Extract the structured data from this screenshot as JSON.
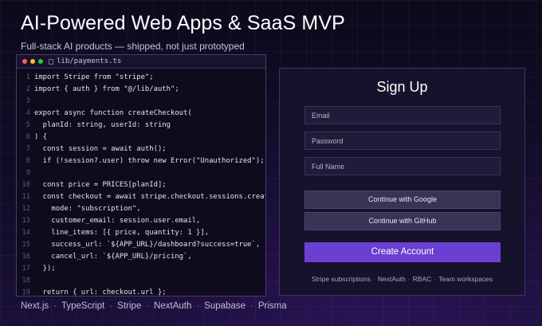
{
  "hero": {
    "title": "AI-Powered Web Apps & SaaS MVP",
    "subtitle": "Full-stack AI products — shipped, not just prototyped"
  },
  "editor": {
    "filename": "lib/payments.ts",
    "icon": "file-icon",
    "lines": [
      {
        "num": "1",
        "code": "import Stripe from \"stripe\";"
      },
      {
        "num": "2",
        "code": "import { auth } from \"@/lib/auth\";"
      },
      {
        "num": "3",
        "code": ""
      },
      {
        "num": "4",
        "code": "export async function createCheckout("
      },
      {
        "num": "5",
        "code": "  planId: string, userId: string"
      },
      {
        "num": "6",
        "code": ") {"
      },
      {
        "num": "7",
        "code": "  const session = await auth();"
      },
      {
        "num": "8",
        "code": "  if (!session?.user) throw new Error(\"Unauthorized\");"
      },
      {
        "num": "9",
        "code": ""
      },
      {
        "num": "10",
        "code": "  const price = PRICES[planId];"
      },
      {
        "num": "11",
        "code": "  const checkout = await stripe.checkout.sessions.create({"
      },
      {
        "num": "12",
        "code": "    mode: \"subscription\","
      },
      {
        "num": "13",
        "code": "    customer_email: session.user.email,"
      },
      {
        "num": "14",
        "code": "    line_items: [{ price, quantity: 1 }],"
      },
      {
        "num": "15",
        "code": "    success_url: `${APP_URL}/dashboard?success=true`,"
      },
      {
        "num": "16",
        "code": "    cancel_url: `${APP_URL}/pricing`,"
      },
      {
        "num": "17",
        "code": "  });"
      },
      {
        "num": "18",
        "code": ""
      },
      {
        "num": "19",
        "code": "  return { url: checkout.url };"
      }
    ]
  },
  "signup": {
    "title": "Sign Up",
    "email_placeholder": "Email",
    "password_placeholder": "Password",
    "fullname_placeholder": "Full Name",
    "google_label": "Continue with Google",
    "github_label": "Continue with GitHub",
    "create_label": "Create Account",
    "features": [
      "Stripe subscriptions",
      "NextAuth",
      "RBAC",
      "Team workspaces"
    ],
    "separator": "·"
  },
  "tech_stack": {
    "items": [
      "Next.js",
      "TypeScript",
      "Stripe",
      "NextAuth",
      "Supabase",
      "Prisma"
    ],
    "separator": "·"
  },
  "colors": {
    "accent": "#6b3fd1",
    "background": "#0d0a1c",
    "card": "#16122b"
  }
}
